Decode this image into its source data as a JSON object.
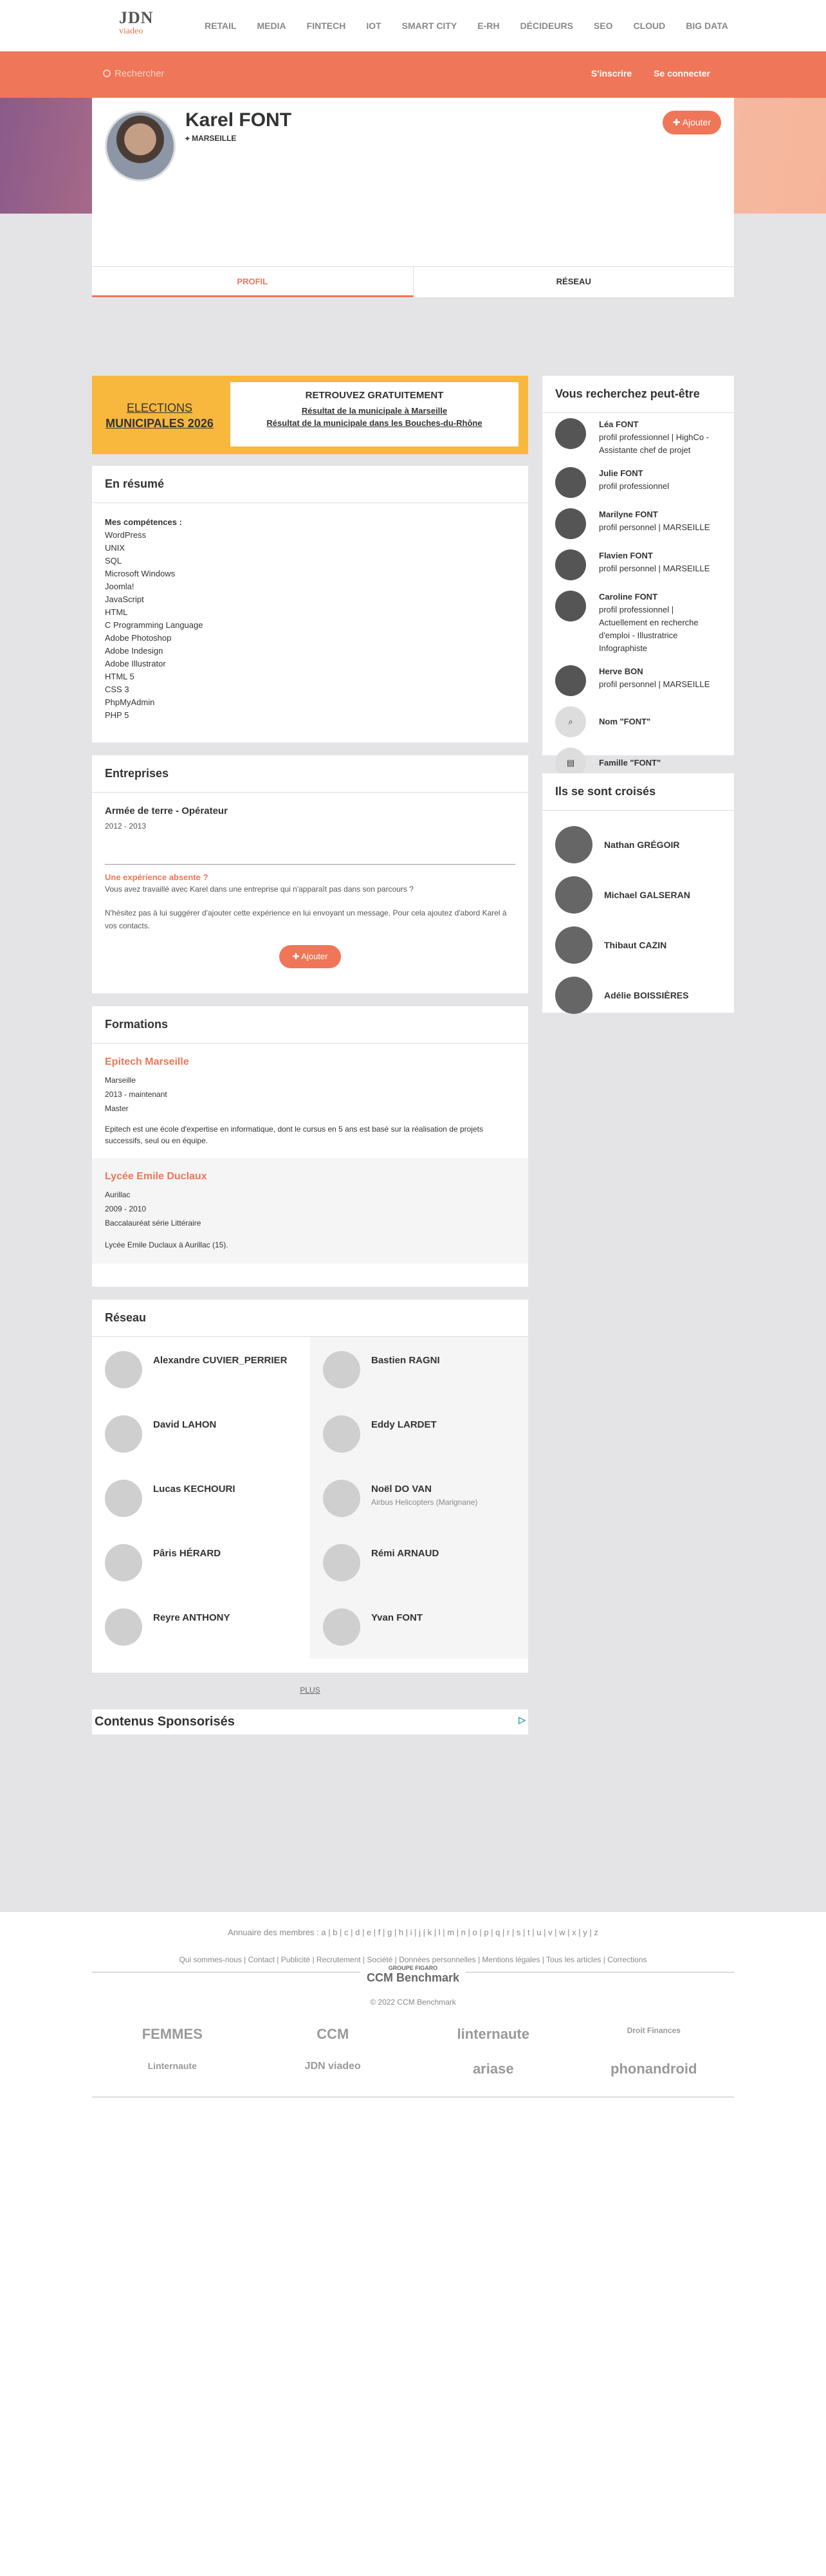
{
  "nav": {
    "logo_top": "JDN",
    "logo_bottom": "viadeo",
    "items": [
      "RETAIL",
      "MEDIA",
      "FINTECH",
      "IOT",
      "SMART CITY",
      "E-RH",
      "DÉCIDEURS",
      "SEO",
      "CLOUD",
      "BIG DATA"
    ]
  },
  "header": {
    "search_placeholder": "Rechercher",
    "signup": "S'inscrire",
    "login": "Se connecter"
  },
  "profile": {
    "name": "Karel FONT",
    "city": "MARSEILLE",
    "add": "Ajouter",
    "tabs": [
      "PROFIL",
      "RÉSEAU"
    ]
  },
  "election": {
    "left1": "ELECTIONS",
    "left2": "MUNICIPALES 2026",
    "title": "RETROUVEZ GRATUITEMENT",
    "link1": "Résultat de la municipale à Marseille",
    "link2": "Résultat de la municipale dans les Bouches-du-Rhône"
  },
  "summary": {
    "title": "En résumé",
    "label": "Mes compétences :",
    "skills": [
      "WordPress",
      "UNIX",
      "SQL",
      "Microsoft Windows",
      "Joomla!",
      "JavaScript",
      "HTML",
      "C Programming Language",
      "Adobe Photoshop",
      "Adobe Indesign",
      "Adobe Illustrator",
      "HTML 5",
      "CSS 3",
      "PhpMyAdmin",
      "PHP 5"
    ]
  },
  "companies": {
    "title": "Entreprises",
    "role": "Armée de terre - Opérateur",
    "dates": "2012 - 2013",
    "absent_title": "Une expérience absente ?",
    "absent_q": "Vous avez travaillé avec Karel dans une entreprise qui n'apparaît pas dans son parcours ?",
    "absent_text": "N'hésitez pas à lui suggérer d'ajouter cette expérience en lui envoyant un message. Pour cela ajoutez d'abord Karel à vos contacts.",
    "add": "Ajouter"
  },
  "formations": {
    "title": "Formations",
    "items": [
      {
        "school": "Epitech Marseille",
        "city": "Marseille",
        "dates": "2013 - maintenant",
        "degree": "Master",
        "desc": "Epitech est une école d'expertise en informatique, dont le cursus en 5 ans est basé sur la réalisation de projets successifs, seul ou en équipe."
      },
      {
        "school": "Lycée Emile Duclaux",
        "city": "Aurillac",
        "dates": "2009 - 2010",
        "degree": "Baccalauréat série Littéraire",
        "desc": "Lycée Emile Duclaux à Aurillac (15)."
      }
    ]
  },
  "network": {
    "title": "Réseau",
    "people": [
      {
        "name": "Alexandre CUVIER_PERRIER",
        "sub": ""
      },
      {
        "name": "Bastien RAGNI",
        "sub": ""
      },
      {
        "name": "David LAHON",
        "sub": ""
      },
      {
        "name": "Eddy LARDET",
        "sub": ""
      },
      {
        "name": "Lucas KECHOURI",
        "sub": ""
      },
      {
        "name": "Noël DO VAN",
        "sub": "Airbus Helicopters (Marignane)"
      },
      {
        "name": "Pâris HÉRARD",
        "sub": ""
      },
      {
        "name": "Rémi ARNAUD",
        "sub": ""
      },
      {
        "name": "Reyre ANTHONY",
        "sub": ""
      },
      {
        "name": "Yvan FONT",
        "sub": ""
      }
    ],
    "plus": "PLUS"
  },
  "sponsored": "Contenus Sponsorisés",
  "suggest": {
    "title": "Vous recherchez peut-être",
    "items": [
      {
        "name": "Léa FONT",
        "sub": "profil professionnel | HighCo - Assistante chef de projet"
      },
      {
        "name": "Julie FONT",
        "sub": "profil professionnel"
      },
      {
        "name": "Marilyne FONT",
        "sub": "profil personnel | MARSEILLE"
      },
      {
        "name": "Flavien FONT",
        "sub": "profil personnel | MARSEILLE"
      },
      {
        "name": "Caroline FONT",
        "sub": "profil professionnel | Actuellement en recherche d'emploi - Illustratrice Infographiste"
      },
      {
        "name": "Herve BON",
        "sub": "profil personnel | MARSEILLE"
      },
      {
        "name": "Nom \"FONT\"",
        "sub": ""
      },
      {
        "name": "Famille \"FONT\"",
        "sub": ""
      }
    ]
  },
  "crossed": {
    "title": "Ils se sont croisés",
    "items": [
      "Nathan GRÉGOIR",
      "Michael GALSERAN",
      "Thibaut CAZIN",
      "Adélie BOISSIÈRES"
    ]
  },
  "footer": {
    "directory": "Annuaire des membres : a | b | c | d | e | f | g | h | i | j | k | l | m | n | o | p | q | r | s | t | u | v | w | x | y | z",
    "links": "Qui sommes-nous | Contact | Publicité | Recrutement | Société | Données personnelles | Mentions légales | Tous les articles | Corrections",
    "brand_small": "GROUPE FIGARO",
    "brand": "CCM Benchmark",
    "copyright": "© 2022 CCM Benchmark",
    "partners": [
      "FEMMES",
      "CCM",
      "linternaute",
      "Droit Finances",
      "Linternaute",
      "JDN viadeo",
      "ariase",
      "phonandroid"
    ]
  }
}
